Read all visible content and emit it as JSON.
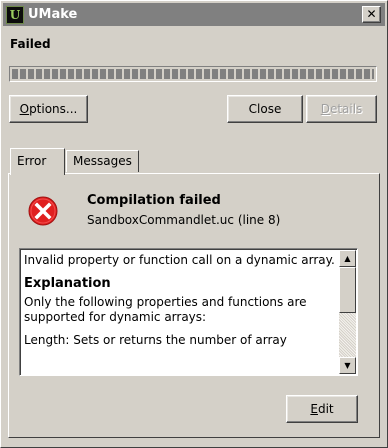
{
  "window": {
    "title": "UMake",
    "app_icon_glyph": "U",
    "close_glyph": "✕"
  },
  "status": {
    "label": "Failed",
    "progress": 1.0
  },
  "buttons": {
    "options_label": "Options...",
    "options_underline": "O",
    "options_rest": "ptions...",
    "close_label": "Close",
    "details_underline": "D",
    "details_rest": "etails",
    "edit_underline": "E",
    "edit_rest": "dit"
  },
  "tabs": [
    {
      "label": "Error",
      "active": true
    },
    {
      "label": "Messages",
      "active": false
    }
  ],
  "error": {
    "icon": "error-x-icon",
    "title": "Compilation failed",
    "file": "SandboxCommandlet.uc (line 8)",
    "message": "Invalid property or function call on a dynamic array.",
    "explanation_heading": "Explanation",
    "explanation_text": "Only the following properties and functions are supported for dynamic arrays:",
    "length_text": "Length: Sets or returns the number of array"
  },
  "colors": {
    "face": "#d4d0c8",
    "titlebar_inactive": "#808080",
    "error_red": "#e02020"
  }
}
